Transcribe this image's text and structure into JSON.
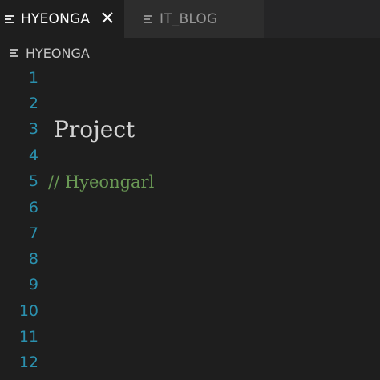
{
  "tabs": [
    {
      "label": "HYEONGA",
      "active": true,
      "icon": "file-lines-icon"
    },
    {
      "label": "IT_BLOG",
      "active": false,
      "icon": "file-lines-icon"
    }
  ],
  "close_icon": "close-icon",
  "breadcrumb": {
    "label": "HYEONGA",
    "icon": "file-lines-icon"
  },
  "editor": {
    "line_numbers": [
      "1",
      "2",
      "3",
      "4",
      "5",
      "6",
      "7",
      "8",
      "9",
      "10",
      "11",
      "12"
    ],
    "lines": {
      "3": "Project",
      "5": "// Hyeongarl"
    }
  },
  "colors": {
    "background": "#1e1e1e",
    "tabbar": "#252526",
    "inactive_tab": "#2d2d2d",
    "line_number": "#2b91af",
    "comment": "#6a9955",
    "text": "#d4d4d4"
  }
}
